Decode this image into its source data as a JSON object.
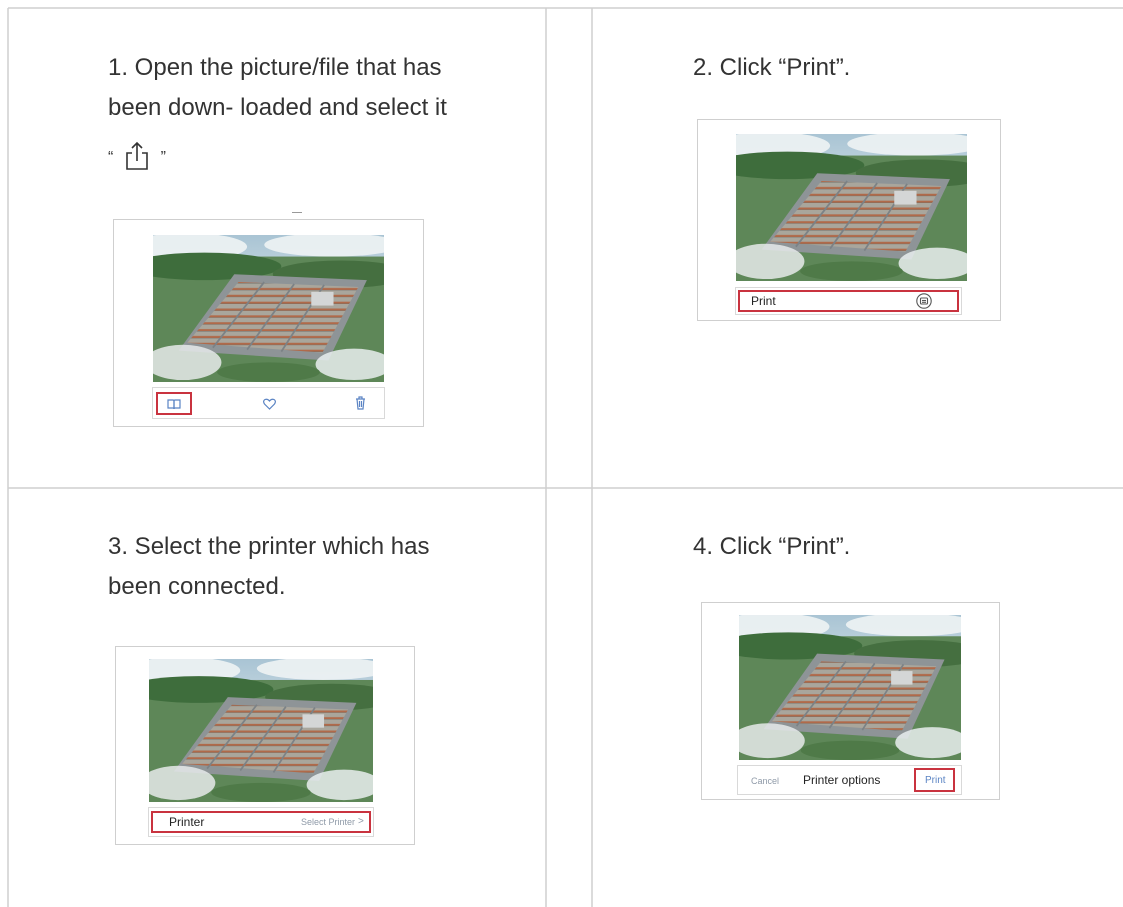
{
  "steps": {
    "step1": {
      "text_line1": "1. Open the picture/file that has",
      "text_line2": "been down- loaded and select it",
      "quote_open": "“",
      "quote_close": "”",
      "share_icon": "share-icon",
      "toolbar_icons": [
        "book-icon",
        "heart-icon",
        "trash-icon"
      ]
    },
    "step2": {
      "text": "2. Click “Print”.",
      "print_label": "Print",
      "print_icon": "printer-icon"
    },
    "step3": {
      "text_line1": "3. Select the printer which has",
      "text_line2": "been connected.",
      "printer_label": "Printer",
      "select_printer": "Select Printer",
      "chevron": ">"
    },
    "step4": {
      "text": "4. Click “Print”.",
      "cancel_label": "Cancel",
      "options_label": "Printer options",
      "print_label": "Print"
    }
  },
  "colors": {
    "highlight": "#c9333f",
    "grid_lines": "#cfcfcf",
    "icon_blue": "#5b84c4"
  }
}
